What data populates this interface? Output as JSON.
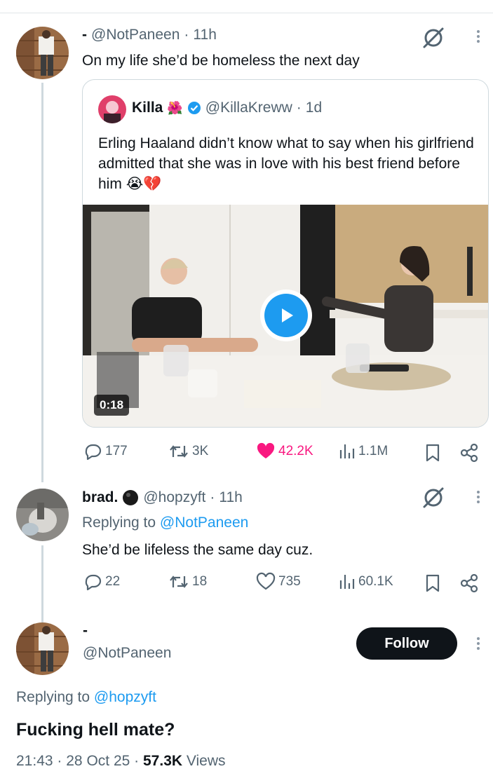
{
  "tweet1": {
    "display_name": "-",
    "handle": "@NotPaneen",
    "time": "11h",
    "text": "On my life she’d be homeless the next day",
    "quote": {
      "name": "Killa",
      "handle": "@KillaKreww",
      "time": "1d",
      "text": "Erling Haaland didn’t know what to say when his girlfriend admitted that she was in love with his best friend before him",
      "emoji": "😭💔",
      "video_duration": "0:18"
    },
    "stats": {
      "replies": "177",
      "retweets": "3K",
      "likes": "42.2K",
      "views": "1.1M"
    }
  },
  "tweet2": {
    "display_name": "brad.",
    "handle": "@hopzyft",
    "time": "11h",
    "replying_prefix": "Replying to",
    "replying_to": "@NotPaneen",
    "text": "She’d be lifeless the same day cuz.",
    "stats": {
      "replies": "22",
      "retweets": "18",
      "likes": "735",
      "views": "60.1K"
    }
  },
  "main": {
    "display_name": "-",
    "handle": "@NotPaneen",
    "follow_label": "Follow",
    "replying_prefix": "Replying to",
    "replying_to": "@hopzyft",
    "text": "Fucking hell mate?",
    "time": "21:43",
    "date": "28 Oct 25",
    "views_count": "57.3K",
    "views_label": "Views"
  },
  "colors": {
    "accent": "#1d9bf0",
    "like": "#f91880",
    "text": "#0f1419",
    "muted": "#536471"
  }
}
